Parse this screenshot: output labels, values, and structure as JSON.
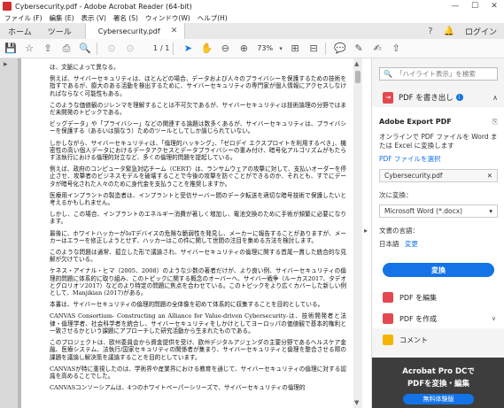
{
  "window": {
    "title": "Cybersecurity.pdf - Adobe Acrobat Reader (64-bit)",
    "controls": [
      "—",
      "☐",
      "✕"
    ]
  },
  "menubar": [
    "ファイル (F)",
    "編集 (E)",
    "表示 (V)",
    "署名 (S)",
    "ウィンドウ(W)",
    "ヘルプ(H)"
  ],
  "tabs": {
    "home": "ホーム",
    "tools": "ツール",
    "document": "Cybersecurity.pdf",
    "login": "ログイン"
  },
  "toolbar": {
    "current_page": "1",
    "total_pages": "/ 1",
    "zoom": "73%"
  },
  "document": {
    "paragraphs": [
      "は、文脈によって異なる。",
      "例えば、サイバーセキュリティは、ほとんどの場合、データおよび人々のプライバシーを保護するための技術を指すであるが、膨大のある活動を検出するために、サイバーセキュリティの専門家が個人情報にアクセスしなければならなく可能性もある。",
      "このような価値観のジレンマを理解することは不可欠であるが、サイバーセキュリティは技術論理の分野ではまだ未開発のトピックである。",
      "ビッグデータ」や「プライバシー」などの関連する論題は数多くあるが、サイバーセキュリティは、プライバシーを保護する（あるいは損なう）ためのツールとしてしか論じられていない。",
      "しかしながら、サイバーセキュリティは、「倫理的ハッキング」、「ゼロデイ エクスプロイトを利用するべき」、機密性の高い個人データにおけるデータアクセスとデータプライバシーの重み付け、暗号化アルゴリズムがもたらす法執行における倫理的対立など、多くの倫理的問題を提起している。",
      "例えば、政府のコンピュータ緊急対応チーム（CERT）は、ランサムウェアの攻撃に対して、支払いオーダーを停止させ、攻撃者のビジネスモデルを破壊することで今後の攻撃を防ぐことができるのか、それとも、すでにデータが暗号化された人々のために身代金を支払うことを推奨しますか。",
      "医療用インプラントの製造者は、インプラントと受信サーバー間のデータ転送を適切な暗号技術で保護したいと考えるかもしれません。",
      "しかし、この場合、インプラントのエネルギー消費が著しく増加し、電池交換のために手術が頻繁に必要になります。",
      "最後に、ホワイトハッカーがIoTデバイスの危険な脆弱性を発見し、メーカーに報告することがありますが、メーカーはエラーを修正しようとせず、ハッカーはこの件に関して世間の注目を集める方法を検討します。",
      "このような問題は通常、孤立した形で議論され、サイバーセキュリティの倫理に関する首尾一貫した統合的な見解が欠けている。",
      "ケネス・アイナル・ヒマ（2005、2008）のような少数の著者だけが、より良い例、サイバーセキュリティの倫理的問題に体系的に取り組み、このトピックに関する概念のオーバーヘ、サイバー戦争（ルーカス2017、タデオとグロリオソ2017）などのより特定の問題に焦点を合わせている。このトピックをより広くカバーした新しい例として、Manjikian (2017)がある。",
      "本書は、サイバーセキュリティの倫理的問題の全体像を初めて体系的に収集することを目的としている。",
      "CANVAS Consortium- Constructing an Alliance for Value-driven Cybersecurity-は、技術開発者と法律・倫理学者、社会科学者を統合し、サイバーセキュリティをしかけとしてヨーロッパの価値観で基本的権利と一致させるかという課題にアプローチした研究活動から生まれたものである。",
      "このプロジェクトは、欧州委員会から資金提供を受け、欧州デジタルアジェンダの主要分野であるヘルスケア金融、医療システム、法執行/国家セキュリティの関係者が集まり、サイバーセキュリティと倫理を整合させる際の課題を議論し解決策を議論することを目的としています。",
      "CANVASが特に重視したのは、学術界や産業界における教育を通じて、サイバーセキュリティの倫理に対する認識を高めることでした。",
      "CANVASコンソーシアムは、4つのホワイトペーパーシリーズで、サイバーセキュリティの倫理的"
    ]
  },
  "rightpane": {
    "search_placeholder": "「ハイライト表示」を検索",
    "export_label": "PDF を書き出し",
    "export_title": "Adobe Export PDF",
    "export_desc": "オンラインで PDF ファイルを Word または Excel に変換します",
    "select_file": "PDF ファイルを選択",
    "filename": "Cybersecurity.pdf",
    "convert_to_label": "次に変換：",
    "convert_option": "Microsoft Word (*.docx)",
    "doc_lang_label": "文書の言語：",
    "doc_lang": "日本語",
    "change": "変更",
    "convert_button": "変換",
    "tools": [
      {
        "label": "PDF を編集",
        "color": "#e34850"
      },
      {
        "label": "PDF を作成",
        "color": "#e34850"
      },
      {
        "label": "コメント",
        "color": "#f5b400"
      }
    ],
    "promo_line1": "Acrobat Pro DCで",
    "promo_line2": "PDFを変換・編集",
    "promo_button": "無料体験版"
  },
  "icons": {
    "nav_left": "chevron-left-icon",
    "collapse": "chevron-right-icon"
  },
  "colors": {
    "accent": "#1473e6",
    "acrobat_red": "#e34850",
    "promo_bg": "#3d3d3d"
  }
}
